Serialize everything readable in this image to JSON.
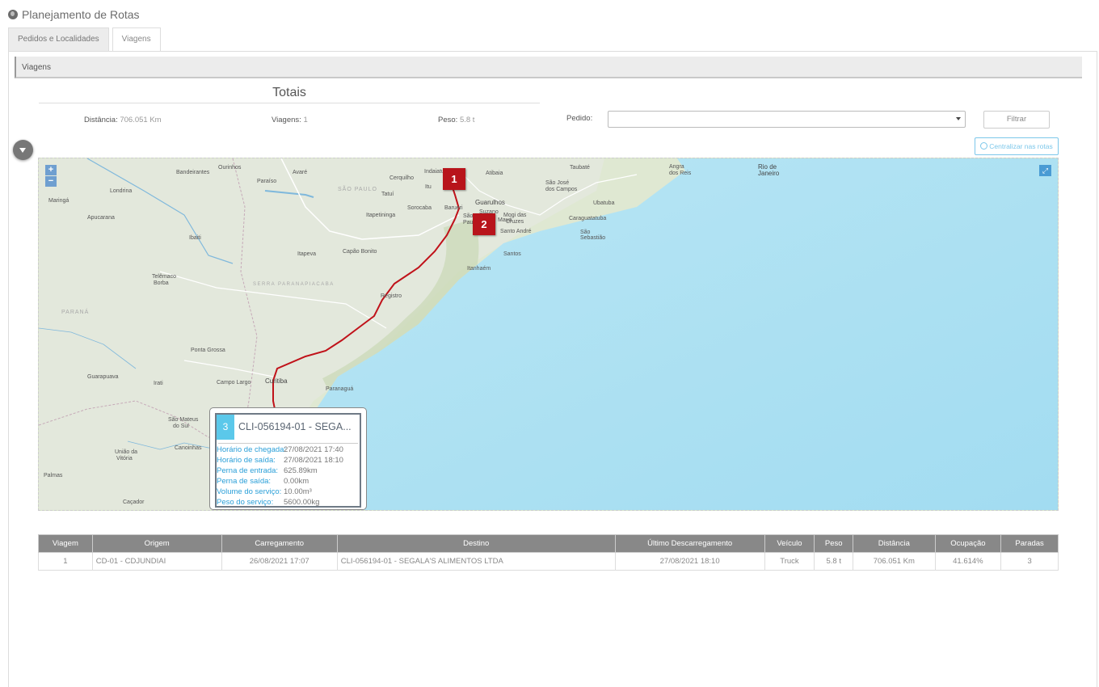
{
  "page": {
    "title": "Planejamento de Rotas",
    "icon": "globe-icon"
  },
  "tabs": [
    {
      "label": "Pedidos e Localidades",
      "active": false
    },
    {
      "label": "Viagens",
      "active": true
    }
  ],
  "panel": {
    "title": "Viagens"
  },
  "totais": {
    "title": "Totais",
    "distancia_label": "Distância:",
    "distancia_value": "706.051 Km",
    "viagens_label": "Viagens:",
    "viagens_value": "1",
    "peso_label": "Peso:",
    "peso_value": "5.8 t"
  },
  "filter": {
    "pedido_label": "Pedido:",
    "pedido_value": "",
    "filtrar_label": "Filtrar"
  },
  "map": {
    "centralizar_label": "Centralizar nas rotas",
    "zoom_in": "+",
    "zoom_out": "−",
    "markers": [
      "1",
      "2"
    ],
    "route_color": "#c0121a",
    "sea_color": "#a9ddf0",
    "places": [
      "Rio de Janeiro",
      "Guarulhos",
      "Santo André",
      "São Paulo",
      "Santos",
      "Itanhaém",
      "Curitiba",
      "Paranaguá",
      "Ponta Grossa",
      "Campo Largo",
      "Registro",
      "Taubaté",
      "São José dos Campos",
      "Mogi das Cruzes",
      "Caraguatatuba",
      "Ubatuba",
      "Angra dos Reis",
      "Londrina",
      "Maringá",
      "Apucarana",
      "Ibaiti",
      "Itapeva",
      "Capão Bonito",
      "Sorocaba",
      "Itapetininga",
      "Tatuí",
      "Barueri",
      "Indaiatuba",
      "Atibaia",
      "Itu",
      "Ourinhos",
      "Bandeirantes",
      "Avaré",
      "Cerquilho",
      "Paraíso",
      "Telêmaco Borba",
      "Guarapuava",
      "Irati",
      "São Mateus do Sul",
      "Canoinhas",
      "União da Vitória",
      "Palmas",
      "Caçador",
      "PARANÁ",
      "SÃO PAULO",
      "SERRA PARANAPIACABA",
      "São Sebastião",
      "Suzano",
      "Mauá"
    ],
    "popup": {
      "num": "3",
      "title": "CLI-056194-01 - SEGA...",
      "rows": [
        {
          "label": "Horário de chegada:",
          "value": "27/08/2021 17:40"
        },
        {
          "label": "Horário de saída:",
          "value": "27/08/2021 18:10"
        },
        {
          "label": "Perna de entrada:",
          "value": "625.89km"
        },
        {
          "label": "Perna de saída:",
          "value": "0.00km"
        },
        {
          "label": "Volume do serviço:",
          "value": "10.00m³"
        },
        {
          "label": "Peso do serviço:",
          "value": "5600.00kg"
        }
      ]
    }
  },
  "table": {
    "headers": [
      "Viagem",
      "Origem",
      "Carregamento",
      "Destino",
      "Último Descarregamento",
      "Veículo",
      "Peso",
      "Distância",
      "Ocupação",
      "Paradas"
    ],
    "rows": [
      [
        "1",
        "CD-01 - CDJUNDIAI",
        "26/08/2021 17:07",
        "CLI-056194-01 - SEGALA'S ALIMENTOS LTDA",
        "27/08/2021 18:10",
        "Truck",
        "5.8 t",
        "706.051 Km",
        "41.614%",
        "3"
      ]
    ]
  }
}
